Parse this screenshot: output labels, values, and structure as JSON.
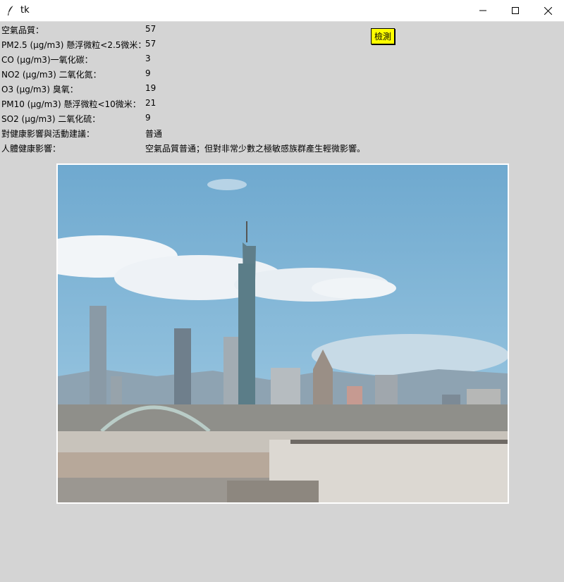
{
  "window": {
    "title": "tk",
    "icon": "feather-icon",
    "controls": [
      "minimize-icon",
      "maximize-icon",
      "close-icon"
    ]
  },
  "rows": [
    {
      "label": "空氣品質：",
      "value": "57"
    },
    {
      "label": "PM2.5 (μg/m3) 懸浮微粒<2.5微米：",
      "value": "57"
    },
    {
      "label": "CO (μg/m3)一氧化碳：",
      "value": "3"
    },
    {
      "label": "NO2 (μg/m3) 二氧化氮：",
      "value": "9"
    },
    {
      "label": "O3 (μg/m3) 臭氧：",
      "value": "19"
    },
    {
      "label": "PM10 (μg/m3) 懸浮微粒<10微米：",
      "value": "21"
    },
    {
      "label": "SO2 (μg/m3) 二氧化硫：",
      "value": "9"
    },
    {
      "label": "對健康影響與活動建議：",
      "value": "普通"
    },
    {
      "label": "人體健康影響：",
      "value": "空氣品質普通；但對非常少數之極敏感族群產生輕微影響。"
    }
  ],
  "detect_button": {
    "label": "檢測",
    "color": "#ffff00"
  },
  "colors": {
    "background": "#d4d4d4",
    "titlebar": "#ffffff"
  }
}
